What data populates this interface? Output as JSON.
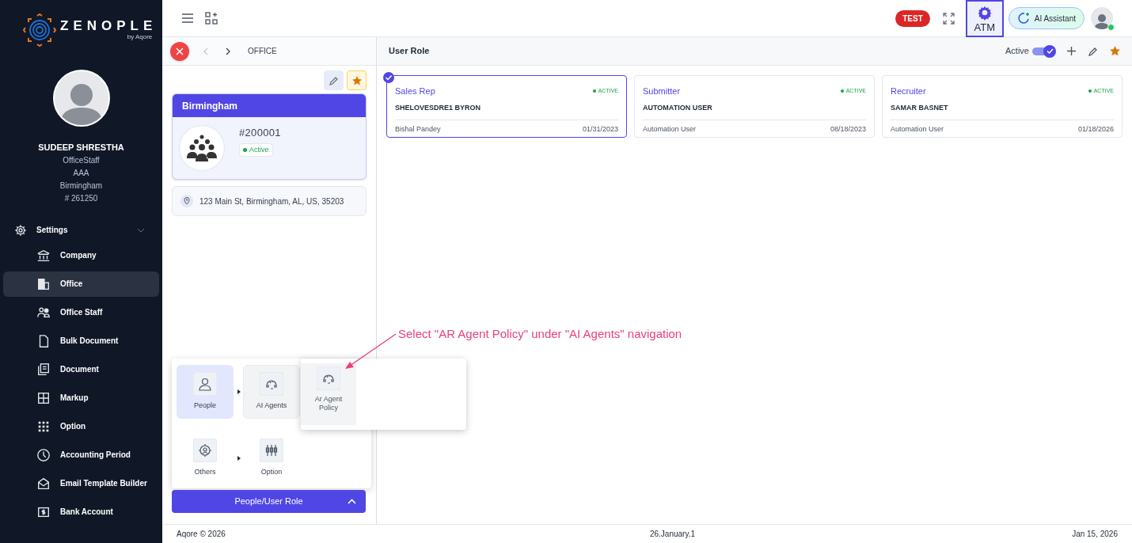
{
  "sidebar": {
    "logo": {
      "name": "ZENOPLE",
      "tagline": "by Aqore"
    },
    "user": {
      "name": "SUDEEP SHRESTHA",
      "lines": [
        "OfficeStaff",
        "AAA",
        "Birmingham",
        "# 261250"
      ]
    },
    "section": {
      "label": "Settings",
      "expanded": true
    },
    "items": [
      {
        "label": "Company",
        "selected": false
      },
      {
        "label": "Office",
        "selected": true
      },
      {
        "label": "Office Staff",
        "selected": false
      },
      {
        "label": "Bulk Document",
        "selected": false
      },
      {
        "label": "Document",
        "selected": false
      },
      {
        "label": "Markup",
        "selected": false
      },
      {
        "label": "Option",
        "selected": false
      },
      {
        "label": "Accounting Period",
        "selected": false
      },
      {
        "label": "Email Template Builder",
        "selected": false
      },
      {
        "label": "Bank Account",
        "selected": false
      }
    ]
  },
  "topbar": {
    "env_badge": "TEST",
    "atm": {
      "label": "ATM",
      "selected": true
    },
    "ai_button": "AI Assistant",
    "user_online": true
  },
  "office_panel": {
    "breadcrumb": "OFFICE",
    "card": {
      "title": "Birmingham",
      "number": "#200001",
      "status": "Active"
    },
    "address": "123 Main St, Birmingham, AL, US, 35203"
  },
  "menu": {
    "items": [
      {
        "label": "People",
        "selected": true,
        "expanded": false,
        "has_submenu": true
      },
      {
        "label": "AI Agents",
        "selected": false,
        "expanded": true,
        "has_submenu": true
      },
      {
        "label": "Others",
        "selected": false,
        "expanded": false,
        "has_submenu": true
      },
      {
        "label": "Option",
        "selected": false,
        "expanded": false,
        "has_submenu": false
      }
    ],
    "submenu": [
      {
        "label": "Ar Agent Policy",
        "hovered": true
      }
    ],
    "toggle_button": {
      "label": "People/User Role",
      "expanded": true
    }
  },
  "user_role": {
    "title": "User Role",
    "active_toggle": {
      "label": "Active",
      "on": true
    },
    "cards": [
      {
        "role": "Sales Rep",
        "status": "ACTIVE",
        "user": "SHELOVESDRE1 BYRON",
        "created_by": "Bishal Pandey",
        "date": "01/31/2023",
        "selected": true
      },
      {
        "role": "Submitter",
        "status": "ACTIVE",
        "user": "AUTOMATION USER",
        "created_by": "Automation User",
        "date": "08/18/2023",
        "selected": false
      },
      {
        "role": "Recruiter",
        "status": "ACTIVE",
        "user": "SAMAR BASNET",
        "created_by": "Automation User",
        "date": "01/18/2026",
        "selected": false
      }
    ]
  },
  "annotation": {
    "text": "Select \"AR Agent Policy\" under \"AI Agents\" navigation"
  },
  "footer": {
    "left": "Aqore © 2026",
    "center": "26.January.1",
    "right": "Jan 15, 2026"
  }
}
